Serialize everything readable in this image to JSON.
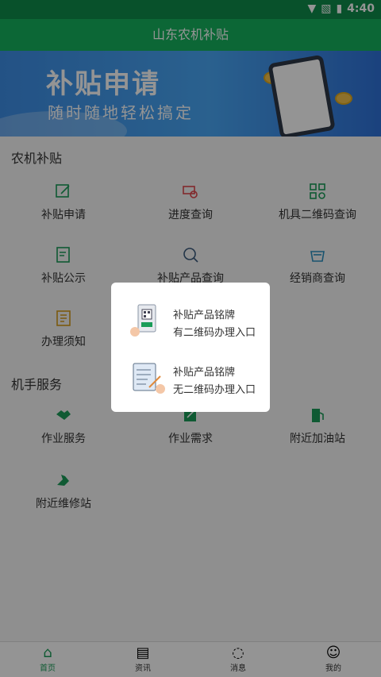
{
  "status_bar": {
    "time": "4:40"
  },
  "app_title": "山东农机补贴",
  "banner": {
    "headline": "补贴申请",
    "tagline": "随时随地轻松搞定"
  },
  "section1": {
    "title": "农机补贴",
    "items": [
      {
        "label": "补贴申请",
        "icon": "edit-icon"
      },
      {
        "label": "进度查询",
        "icon": "progress-search-icon"
      },
      {
        "label": "机具二维码查询",
        "icon": "qr-grid-icon"
      },
      {
        "label": "补贴公示",
        "icon": "notice-icon"
      },
      {
        "label": "补贴产品查询",
        "icon": "product-search-icon"
      },
      {
        "label": "经销商查询",
        "icon": "store-icon"
      },
      {
        "label": "办理须知",
        "icon": "guide-icon"
      }
    ]
  },
  "section2": {
    "title": "机手服务",
    "items": [
      {
        "label": "作业服务",
        "icon": "handshake-icon"
      },
      {
        "label": "作业需求",
        "icon": "demand-icon"
      },
      {
        "label": "附近加油站",
        "icon": "fuel-icon"
      },
      {
        "label": "附近维修站",
        "icon": "repair-icon"
      }
    ]
  },
  "dialog": {
    "options": [
      {
        "line1": "补贴产品铭牌",
        "line2": "有二维码办理入口"
      },
      {
        "line1": "补贴产品铭牌",
        "line2": "无二维码办理入口"
      }
    ]
  },
  "tabs": [
    {
      "label": "首页",
      "icon": "home-icon",
      "active": true
    },
    {
      "label": "资讯",
      "icon": "news-icon",
      "active": false
    },
    {
      "label": "消息",
      "icon": "message-icon",
      "active": false
    },
    {
      "label": "我的",
      "icon": "profile-icon",
      "active": false
    }
  ],
  "colors": {
    "brand_green": "#16b25e",
    "status_green": "#0f8c4a",
    "icon_green": "#1a9c58"
  }
}
